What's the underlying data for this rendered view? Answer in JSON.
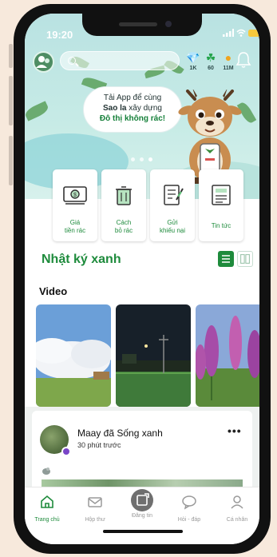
{
  "status": {
    "time": "19:20"
  },
  "header": {
    "search_placeholder": "",
    "stats": [
      {
        "icon": "diamond-icon",
        "value": "1K",
        "color": "#1a73e8"
      },
      {
        "icon": "clover-icon",
        "value": "60",
        "color": "#22a34a"
      },
      {
        "icon": "coin-icon",
        "value": "11M",
        "color": "#f0a41e"
      }
    ]
  },
  "banner": {
    "line1": "Tải App để cùng",
    "line2_bold": "Sao la",
    "line2_rest": " xây dựng",
    "line3": "Đô thị không rác!",
    "slide_index": 3,
    "slide_count": 3
  },
  "quick_actions": [
    {
      "icon": "money-icon",
      "label": "Giá\ntiền rác"
    },
    {
      "icon": "sort-trash-icon",
      "label": "Cách\nbỏ rác"
    },
    {
      "icon": "complaint-icon",
      "label": "Gửi\nkhiếu nại"
    },
    {
      "icon": "newspaper-icon",
      "label": "Tin tức"
    }
  ],
  "green_diary": {
    "title": "Nhật ký xanh"
  },
  "video": {
    "title": "Video"
  },
  "post": {
    "author": "Maay",
    "action": " đã Sống xanh",
    "time": "30 phút trước",
    "more": "•••"
  },
  "tabs": [
    {
      "icon": "home-icon",
      "label": "Trang chủ",
      "active": true
    },
    {
      "icon": "mail-icon",
      "label": "Hộp thư",
      "active": false
    },
    {
      "icon": "post-icon",
      "label": "Đăng tin",
      "active": false
    },
    {
      "icon": "chat-icon",
      "label": "Hỏi - đáp",
      "active": false
    },
    {
      "icon": "profile-icon",
      "label": "Cá nhân",
      "active": false
    }
  ],
  "colors": {
    "brand": "#1e8b3c",
    "hero_bg": "#c4e8e5",
    "inactive_tab": "#9a9a9a"
  }
}
